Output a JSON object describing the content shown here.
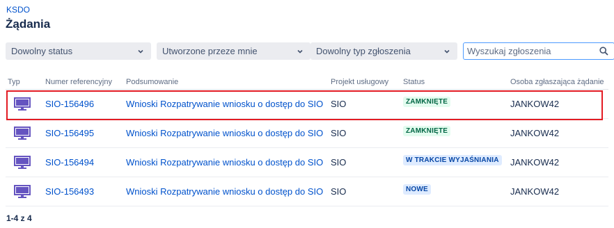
{
  "breadcrumb": "KSDO",
  "title": "Żądania",
  "filters": {
    "status": "Dowolny status",
    "creator": "Utworzone przeze mnie",
    "request_type": "Dowolny typ zgłoszenia",
    "search_placeholder": "Wyszukaj zgłoszenia"
  },
  "columns": {
    "type": "Typ",
    "reference": "Numer referencyjny",
    "summary": "Podsumowanie",
    "project": "Projekt usługowy",
    "status": "Status",
    "reporter": "Osoba zgłaszająca żądanie"
  },
  "rows": [
    {
      "type_icon": "monitor-icon",
      "reference": "SIO-156496",
      "summary": "Wnioski Rozpatrywanie wniosku o dostęp do SIO",
      "project": "SIO",
      "status": "ZAMKNIĘTE",
      "status_color": "#006644",
      "reporter": "JANKOW42"
    },
    {
      "type_icon": "monitor-icon",
      "reference": "SIO-156495",
      "summary": "Wnioski Rozpatrywanie wniosku o dostęp do SIO",
      "project": "SIO",
      "status": "ZAMKNIĘTE",
      "status_color": "#006644",
      "reporter": "JANKOW42"
    },
    {
      "type_icon": "monitor-icon",
      "reference": "SIO-156494",
      "summary": "Wnioski Rozpatrywanie wniosku o dostęp do SIO",
      "project": "SIO",
      "status": "W TRAKCIE WYJAŚNIANIA",
      "status_color": "#0747a6",
      "reporter": "JANKOW42"
    },
    {
      "type_icon": "monitor-icon",
      "reference": "SIO-156493",
      "summary": "Wnioski Rozpatrywanie wniosku o dostęp do SIO",
      "project": "SIO",
      "status": "NOWE",
      "status_color": "#0747a6",
      "reporter": "JANKOW42"
    }
  ],
  "pagination": "1-4 z 4",
  "colors": {
    "link": "#0052cc",
    "highlight": "#e31b23",
    "icon": "#6554c0"
  }
}
